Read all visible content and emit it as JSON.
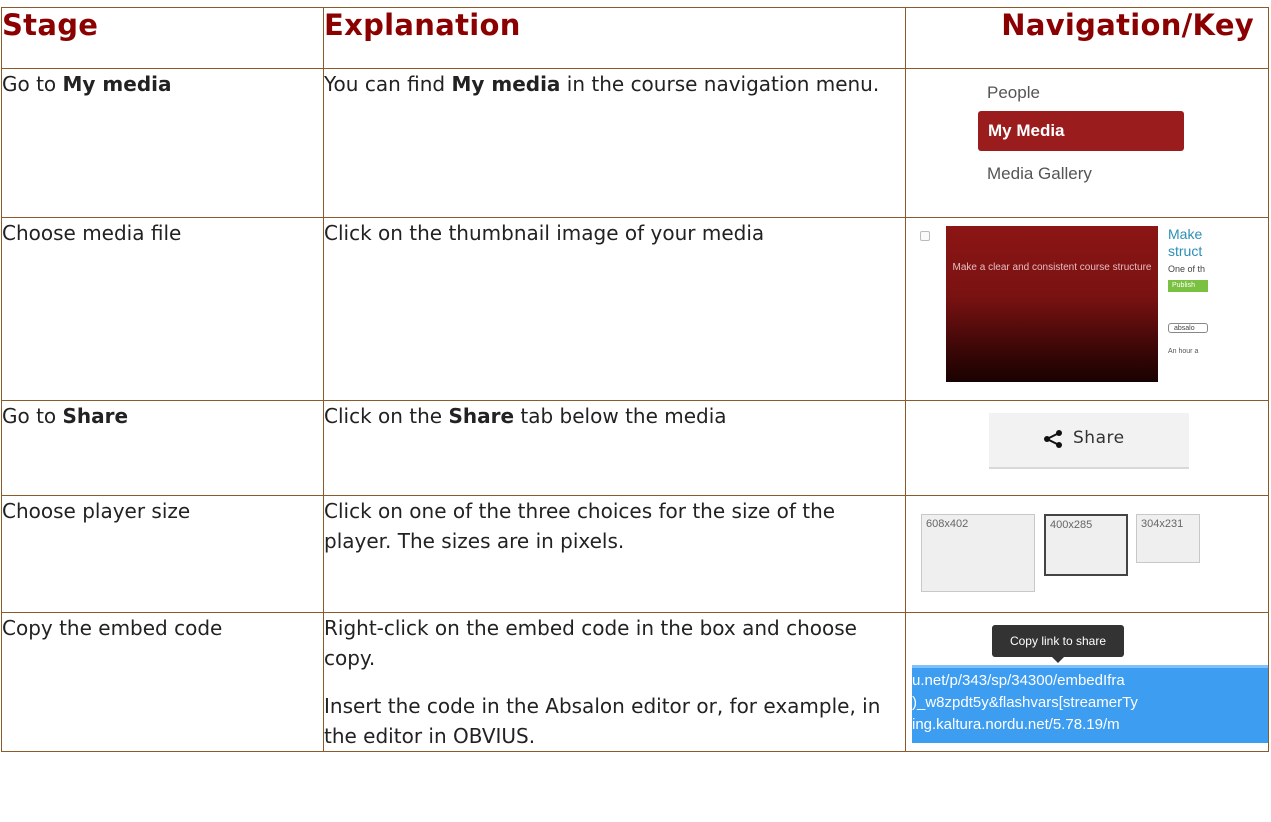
{
  "headers": {
    "stage": "Stage",
    "explanation": "Explanation",
    "key": "Navigation/Key"
  },
  "rows": [
    {
      "stage_prefix": "Go to ",
      "stage_bold": "My media",
      "exp_prefix": "You can find ",
      "exp_bold": "My media",
      "exp_suffix": " in the course navigation menu."
    },
    {
      "stage": "Choose media file",
      "exp": "Click on the thumbnail image of your media"
    },
    {
      "stage_prefix": "Go to ",
      "stage_bold": "Share",
      "exp_prefix": "Click on the ",
      "exp_bold": "Share",
      "exp_suffix": " tab below the media"
    },
    {
      "stage": "Choose player size",
      "exp": "Click on one of the three choices for the size of the player. The sizes are in pixels."
    },
    {
      "stage": "Copy the embed code",
      "exp_p1": "Right-click on the embed code in the box and choose copy.",
      "exp_p2": "Insert the code in the Absalon editor or, for example, in the editor in OBVIUS."
    }
  ],
  "nav_menu": {
    "people": "People",
    "my_media": "My Media",
    "gallery": "Media Gallery",
    "accent": "#9b1c1c"
  },
  "media_entry": {
    "thumb_text": "Make a clear and consistent course structure",
    "title_l1": "Make",
    "title_l2": "struct",
    "desc": "One of th",
    "status": "Publish",
    "tag": "absalo",
    "time": "An hour a"
  },
  "share_tab": {
    "label": "Share",
    "icon": "share-icon"
  },
  "player_sizes": {
    "large": "608x402",
    "medium": "400x285",
    "small": "304x231"
  },
  "embed": {
    "tooltip": "Copy link to share",
    "line1": "u.net/p/343/sp/34300/embedIfra",
    "line2": ")_w8zpdt5y&flashvars[streamerTy",
    "line3": "ing.kaltura.nordu.net/5.78.19/m"
  },
  "colors": {
    "heading": "#8b0000",
    "border": "#8b5a2b",
    "selection": "#3d9df0"
  }
}
